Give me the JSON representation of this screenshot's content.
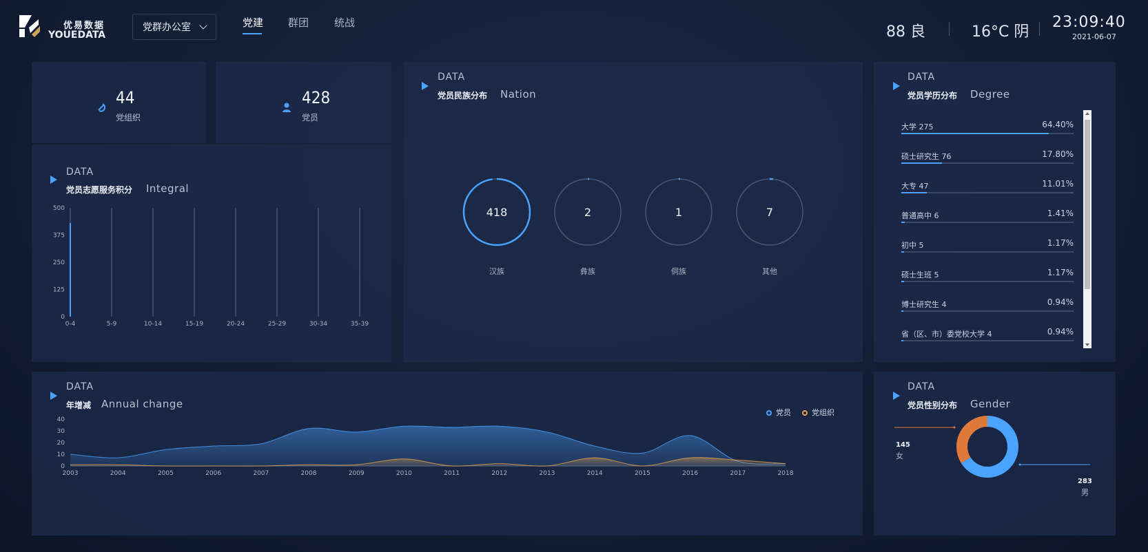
{
  "header": {
    "logo_cn": "优易数据",
    "logo_en": "YOUEDATA",
    "dept_select": "党群办公室",
    "tabs": [
      {
        "label": "党建",
        "active": true
      },
      {
        "label": "群团",
        "active": false
      },
      {
        "label": "统战",
        "active": false
      }
    ],
    "air_quality": "88 良",
    "weather": "16°C 阴",
    "time": "23:09:40",
    "date": "2021-06-07"
  },
  "stats": {
    "org_count": "44",
    "org_label": "党组织",
    "member_count": "428",
    "member_label": "党员"
  },
  "integral": {
    "data_label": "DATA",
    "title_cn": "党员志愿服务积分",
    "title_en": "Integral"
  },
  "nation": {
    "data_label": "DATA",
    "title_cn": "党员民族分布",
    "title_en": "Nation",
    "items": [
      {
        "value": "418",
        "label": "汉族"
      },
      {
        "value": "2",
        "label": "彝族"
      },
      {
        "value": "1",
        "label": "侗族"
      },
      {
        "value": "7",
        "label": "其他"
      }
    ]
  },
  "degree": {
    "data_label": "DATA",
    "title_cn": "党员学历分布",
    "title_en": "Degree",
    "items": [
      {
        "name": "大学 275",
        "pct": "64.40%",
        "frac": 0.644
      },
      {
        "name": "硕士研究生 76",
        "pct": "17.80%",
        "frac": 0.178
      },
      {
        "name": "大专 47",
        "pct": "11.01%",
        "frac": 0.1101
      },
      {
        "name": "普通高中 6",
        "pct": "1.41%",
        "frac": 0.0141
      },
      {
        "name": "初中 5",
        "pct": "1.17%",
        "frac": 0.0117
      },
      {
        "name": "硕士生班 5",
        "pct": "1.17%",
        "frac": 0.0117
      },
      {
        "name": "博士研究生 4",
        "pct": "0.94%",
        "frac": 0.0094
      },
      {
        "name": "省（区、市）委党校大学 4",
        "pct": "0.94%",
        "frac": 0.0094
      }
    ]
  },
  "annual": {
    "data_label": "DATA",
    "title_cn": "年增减",
    "title_en": "Annual change"
  },
  "gender": {
    "data_label": "DATA",
    "title_cn": "党员性别分布",
    "title_en": "Gender",
    "female_value": "145",
    "female_label": "女",
    "male_value": "283",
    "male_label": "男"
  },
  "colors": {
    "accent": "#4aa3ff",
    "orange": "#e07a3a",
    "series_member": "#4aa3ff",
    "series_org": "#e8a34a"
  },
  "chart_data": [
    {
      "type": "bar",
      "title": "党员志愿服务积分 Integral",
      "categories": [
        "0-4",
        "5-9",
        "10-14",
        "15-19",
        "20-24",
        "25-29",
        "30-34",
        "35-39"
      ],
      "values": [
        430,
        0,
        0,
        0,
        0,
        0,
        0,
        0
      ],
      "ylim": [
        0,
        500
      ],
      "yticks": [
        "0",
        "125",
        "250",
        "375",
        "500"
      ]
    },
    {
      "type": "area",
      "title": "年增减 Annual change",
      "categories": [
        "2003",
        "2004",
        "2005",
        "2006",
        "2007",
        "2008",
        "2009",
        "2010",
        "2011",
        "2012",
        "2013",
        "2014",
        "2015",
        "2016",
        "2017",
        "2018"
      ],
      "ylim": [
        0,
        40
      ],
      "yticks": [
        "0",
        "10",
        "20",
        "30",
        "40"
      ],
      "series": [
        {
          "name": "党员",
          "values": [
            10,
            7,
            14,
            17,
            19,
            32,
            29,
            34,
            33,
            34,
            29,
            17,
            11,
            26,
            4,
            2
          ]
        },
        {
          "name": "党组织",
          "values": [
            1,
            1,
            0,
            0,
            0,
            1,
            1,
            6,
            0,
            2,
            0,
            7,
            0,
            7,
            5,
            2
          ]
        }
      ]
    },
    {
      "type": "pie",
      "title": "党员性别分布 Gender",
      "categories": [
        "男",
        "女"
      ],
      "values": [
        283,
        145
      ]
    }
  ]
}
